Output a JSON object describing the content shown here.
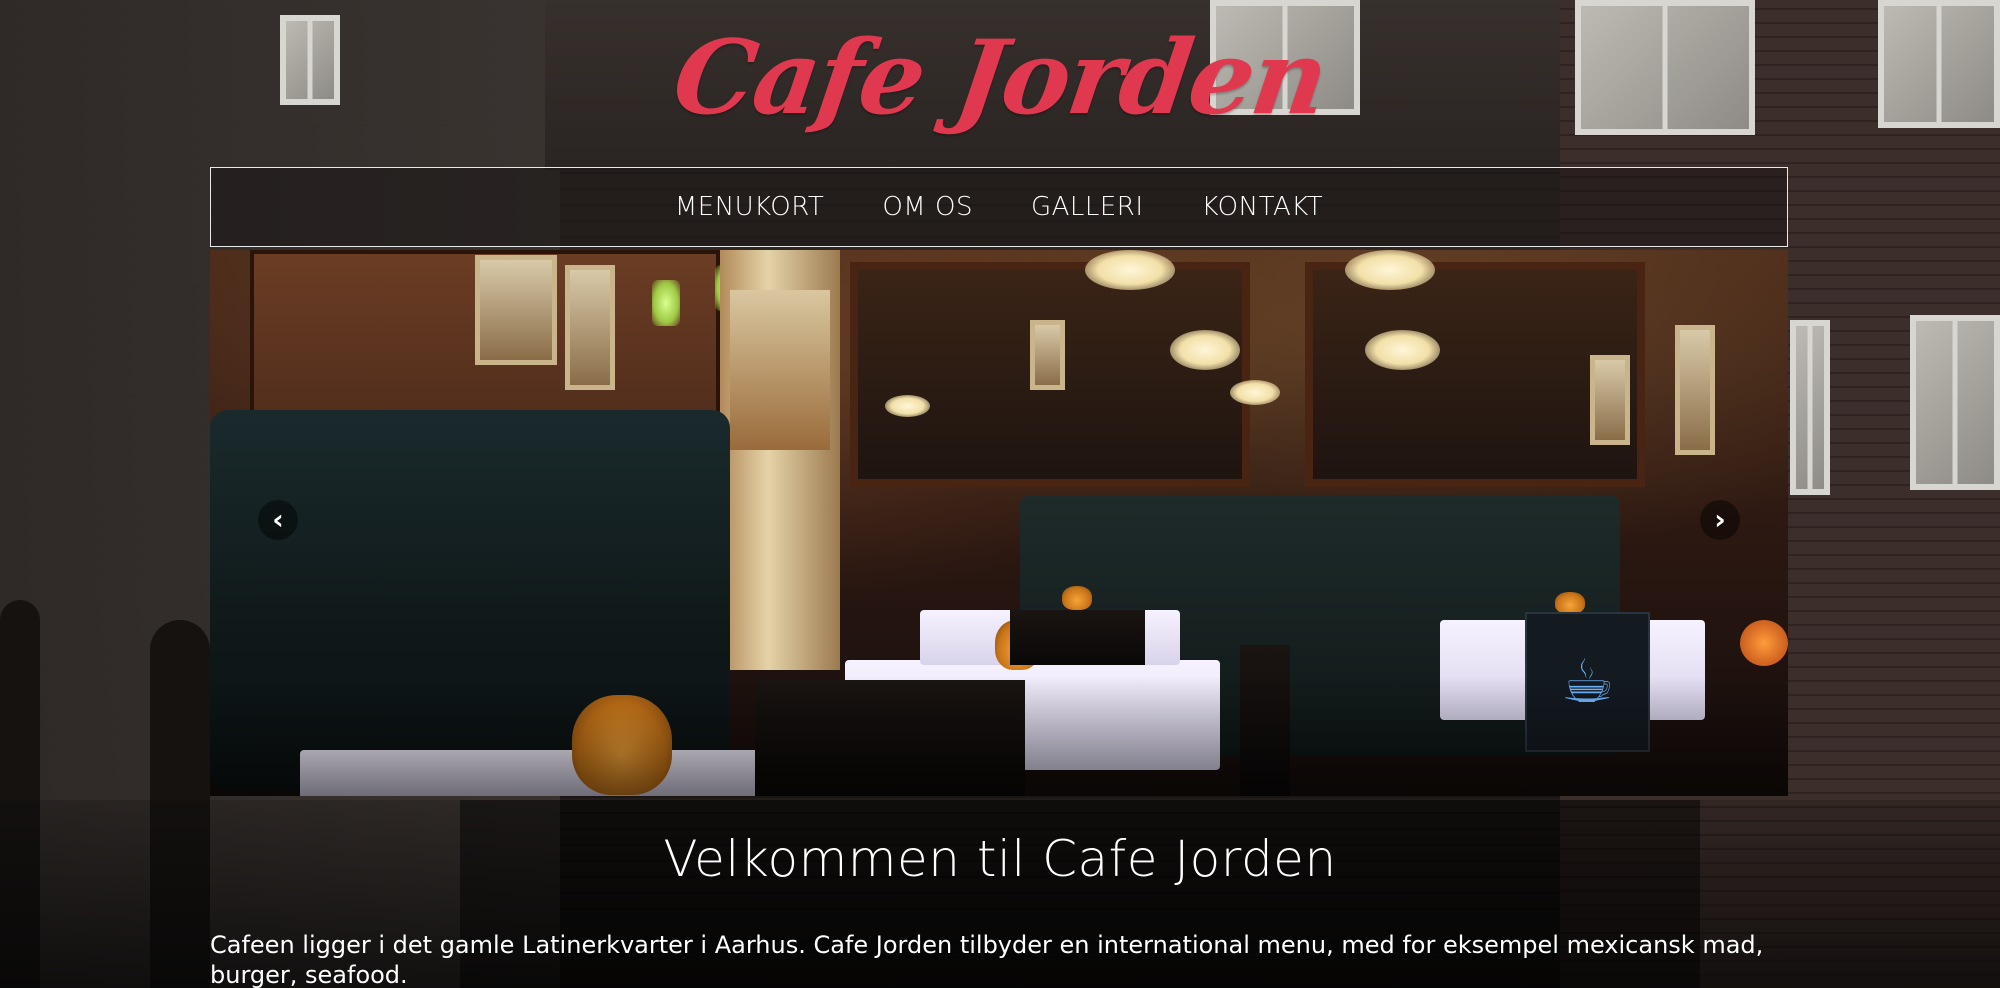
{
  "brand": {
    "logo_text": "Cafe Jorden",
    "logo_color": "#e0384f"
  },
  "nav": {
    "items": [
      {
        "label": "MENUKORT"
      },
      {
        "label": "OM OS"
      },
      {
        "label": "GALLERI"
      },
      {
        "label": "KONTAKT"
      }
    ]
  },
  "carousel": {
    "prev_icon": "chevron-left-icon",
    "next_icon": "chevron-right-icon",
    "prev_glyph": "‹",
    "next_glyph": "›",
    "sign_glyph": "☕"
  },
  "main": {
    "title": "Velkommen til Cafe Jorden",
    "intro": "Cafeen ligger i det gamle Latinerkvarter i Aarhus. Cafe Jorden tilbyder en international menu, med for eksempel mexicansk mad, burger, seafood."
  }
}
